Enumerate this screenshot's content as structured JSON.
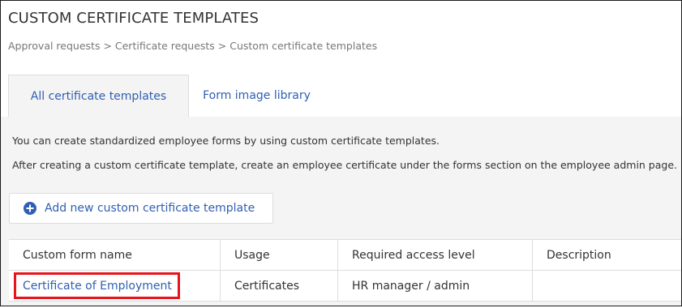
{
  "page": {
    "title": "CUSTOM CERTIFICATE TEMPLATES",
    "breadcrumb": "Approval requests > Certificate requests > Custom certificate templates"
  },
  "tabs": [
    {
      "label": "All certificate templates",
      "active": true
    },
    {
      "label": "Form image library",
      "active": false
    }
  ],
  "info": {
    "line1": "You can create standardized employee forms by using custom certificate templates.",
    "line2": "After creating a custom certificate template, create an employee certificate under the forms section on the employee admin page."
  },
  "add_button": {
    "label": "Add new custom certificate template",
    "icon": "plus-circle-icon"
  },
  "table": {
    "columns": [
      "Custom form name",
      "Usage",
      "Required access level",
      "Description"
    ],
    "rows": [
      {
        "name": "Certificate of Employment",
        "usage": "Certificates",
        "access_level": "HR manager / admin",
        "description": ""
      }
    ]
  },
  "colors": {
    "link": "#2f5fb3",
    "highlight": "#e8141c",
    "content_bg": "#f4f4f4",
    "border": "#dddddd"
  }
}
